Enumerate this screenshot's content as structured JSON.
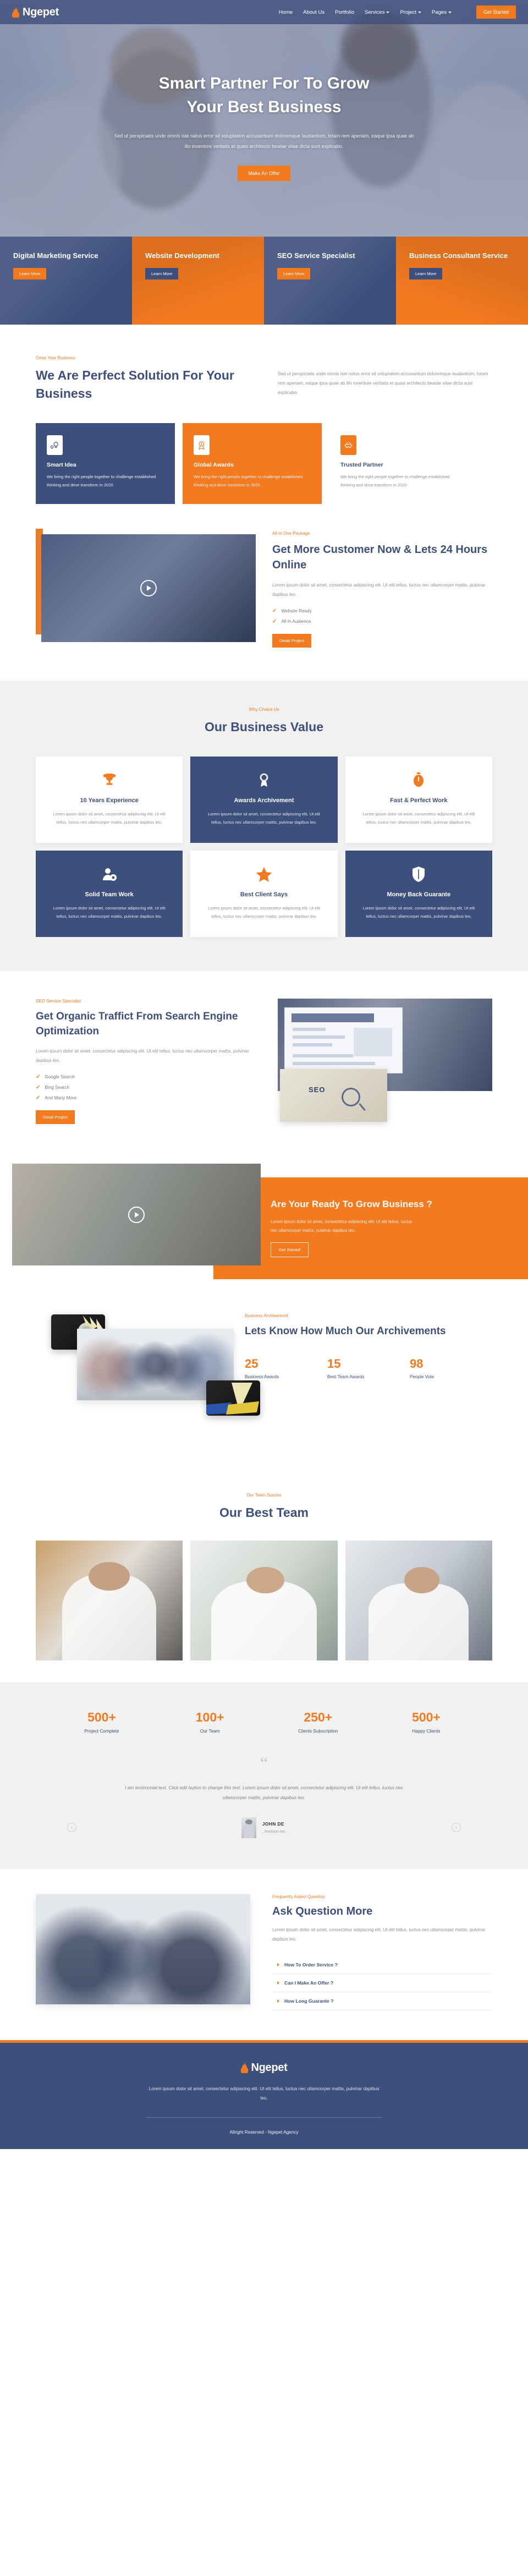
{
  "brand": {
    "name": "Ngepet",
    "icon": "flame-icon"
  },
  "header": {
    "nav": [
      {
        "label": "Home",
        "caret": false
      },
      {
        "label": "About Us",
        "caret": false
      },
      {
        "label": "Portfolio",
        "caret": false
      },
      {
        "label": "Services",
        "caret": true
      },
      {
        "label": "Project",
        "caret": true
      },
      {
        "label": "Pages",
        "caret": true
      }
    ],
    "cta": "Get Started"
  },
  "hero": {
    "title_line1": "Smart Partner For To Grow",
    "title_line2": "Your Best Business",
    "paragraph": "Sed ut perspiciatis unde omnis iste natus error sit voluptatem accusantium doloremque laudantium, totam rem aperiam, eaque ipsa quae ab illo inventore veritatis et quasi architecto beatae vitae dicta sunt explicabo.",
    "cta": "Make An Offer"
  },
  "service_tiles": [
    {
      "title": "Digital Marketing Service",
      "cta": "Learn More",
      "style": "blue"
    },
    {
      "title": "Website Development",
      "cta": "Learn More",
      "style": "orange"
    },
    {
      "title": "SEO Service Specialist",
      "cta": "Learn More",
      "style": "blue"
    },
    {
      "title": "Business Consultant Service",
      "cta": "Learn More",
      "style": "orange"
    }
  ],
  "perfect": {
    "eyebrow": "Grow Your Business",
    "title": "We Are Perfect Solution For Your Business",
    "paragraph": "Sed ut perspiciatis unde omnis iste natus error sit voluptatem accusantium doloremque laudantium, totam rem aperiam, eaque ipsa quae ab illo inventore veritatis et quasi architecto beatae vitae dicta sunt explicabo.",
    "features": [
      {
        "icon": "lightbulb-icon",
        "title": "Smart Idea",
        "text": "We bring the right people together to challenge established thinking and drive transform in 2020"
      },
      {
        "icon": "award-ribbon-icon",
        "title": "Global Awards",
        "text": "We bring the right people together to challenge established thinking and drive transform in 2020"
      },
      {
        "icon": "handshake-icon",
        "title": "Trusted Partner",
        "text": "We bring the right people together to challenge established thinking and drive transform in 2020"
      }
    ]
  },
  "package": {
    "eyebrow": "All In One Package",
    "title": "Get More Customer Now & Lets 24 Hours Online",
    "paragraph": "Lorem ipsum dolor sit amet, consectetur adipiscing elit. Ut elit tellus, luctus nec ullamcorper mattis, pulvinar dapibus leo.",
    "checks": [
      "Website Ready",
      "All In Audience"
    ],
    "cta": "Detail Project"
  },
  "value": {
    "eyebrow": "Why Choice Us",
    "title": "Our Business Value",
    "cards": [
      {
        "icon": "trophy-icon",
        "title": "10 Years Experience",
        "text": "Lorem ipsum dolor sit amet, consectetur adipiscing elit. Ut elit tellus, luctus nec ullamcorper mattis, pulvinar dapibus leo.",
        "style": "white"
      },
      {
        "icon": "award-icon",
        "title": "Awards Archivement",
        "text": "Lorem ipsum dolor sit amet, consectetur adipiscing elit. Ut elit tellus, luctus nec ullamcorper mattis, pulvinar dapibus leo.",
        "style": "navy"
      },
      {
        "icon": "stopwatch-icon",
        "title": "Fast & Perfect Work",
        "text": "Lorem ipsum dolor sit amet, consectetur adipiscing elit. Ut elit tellus, luctus nec ullamcorper mattis, pulvinar dapibus leo.",
        "style": "white"
      },
      {
        "icon": "user-gear-icon",
        "title": "Solid Team Work",
        "text": "Lorem ipsum dolor sit amet, consectetur adipiscing elit. Ut elit tellus, luctus nec ullamcorper mattis, pulvinar dapibus leo.",
        "style": "navy"
      },
      {
        "icon": "star-icon",
        "title": "Best Client Says",
        "text": "Lorem ipsum dolor sit amet, consectetur adipiscing elit. Ut elit tellus, luctus nec ullamcorper mattis, pulvinar dapibus leo.",
        "style": "white"
      },
      {
        "icon": "shield-icon",
        "title": "Money Back Guarante",
        "text": "Lorem ipsum dolor sit amet, consectetur adipiscing elit. Ut elit tellus, luctus nec ullamcorper mattis, pulvinar dapibus leo.",
        "style": "navy"
      }
    ]
  },
  "seo": {
    "eyebrow": "SEO Service Specialist",
    "title": "Get Organic Traffict From Search Engine Optimization",
    "paragraph": "Lorem ipsum dolor sit amet, consectetur adipiscing elit. Ut elit tellus, luctus nec ullamcorper mattis, pulvinar dapibus leo.",
    "checks": [
      "Google Search",
      "Bing Search",
      "And Many More"
    ],
    "cta": "Detail Project",
    "card_label": "SEO"
  },
  "ready": {
    "title": "Are Your Ready To Grow Business ?",
    "paragraph": "Lorem ipsum dolor sit amet, consectetur adipiscing elit. Ut elit tellus, luctus nec ullamcorper mattis, pulvinar dapibus leo.",
    "cta": "Get Started"
  },
  "achievement": {
    "eyebrow": "Business Archivement",
    "title": "Lets Know How Much Our Archivements",
    "stats": [
      {
        "num": "25",
        "label": "Business Awards"
      },
      {
        "num": "15",
        "label": "Best Team Awards"
      },
      {
        "num": "98",
        "label": "People Vote"
      }
    ]
  },
  "team": {
    "eyebrow": "Our Team Succes",
    "title": "Our Best Team"
  },
  "counters": [
    {
      "num": "500+",
      "label": "Project Complete"
    },
    {
      "num": "100+",
      "label": "Our Team"
    },
    {
      "num": "250+",
      "label": "Clients Subscription"
    },
    {
      "num": "500+",
      "label": "Happy Clients"
    }
  ],
  "testimonial": {
    "quote_mark": "“",
    "text": "I am testimonial text. Click edit button to change this text. Lorem ipsum dolor sit amet, consectetur adipiscing elit. Ut elit tellus, luctus nec ullamcorper mattis, pulvinar dapibus leo.",
    "name": "JOHN DE",
    "company": ", Invision Inc.",
    "prev": "‹",
    "next": "›"
  },
  "faq": {
    "eyebrow": "Frequently Asked Question",
    "title": "Ask Question More",
    "paragraph": "Lorem ipsum dolor sit amet, consectetur adipiscing elit. Ut elit tellus, luctus nec ullamcorper mattis, pulvinar dapibus leo.",
    "items": [
      "How To Order Service ?",
      "Can I Make An Offer ?",
      "How Long Guarante ?"
    ]
  },
  "footer": {
    "paragraph": "Lorem ipsum dolor sit amet, consectetur adipiscing elit. Ut elit tellus, luctus nec ullamcorper mattis, pulvinar dapibus leo.",
    "copyright": "Allright Reserved - Ngepet Agency"
  },
  "colors": {
    "navy": "#3d4f7c",
    "orange": "#f47a20",
    "grey_bg": "#f1f1f1"
  }
}
